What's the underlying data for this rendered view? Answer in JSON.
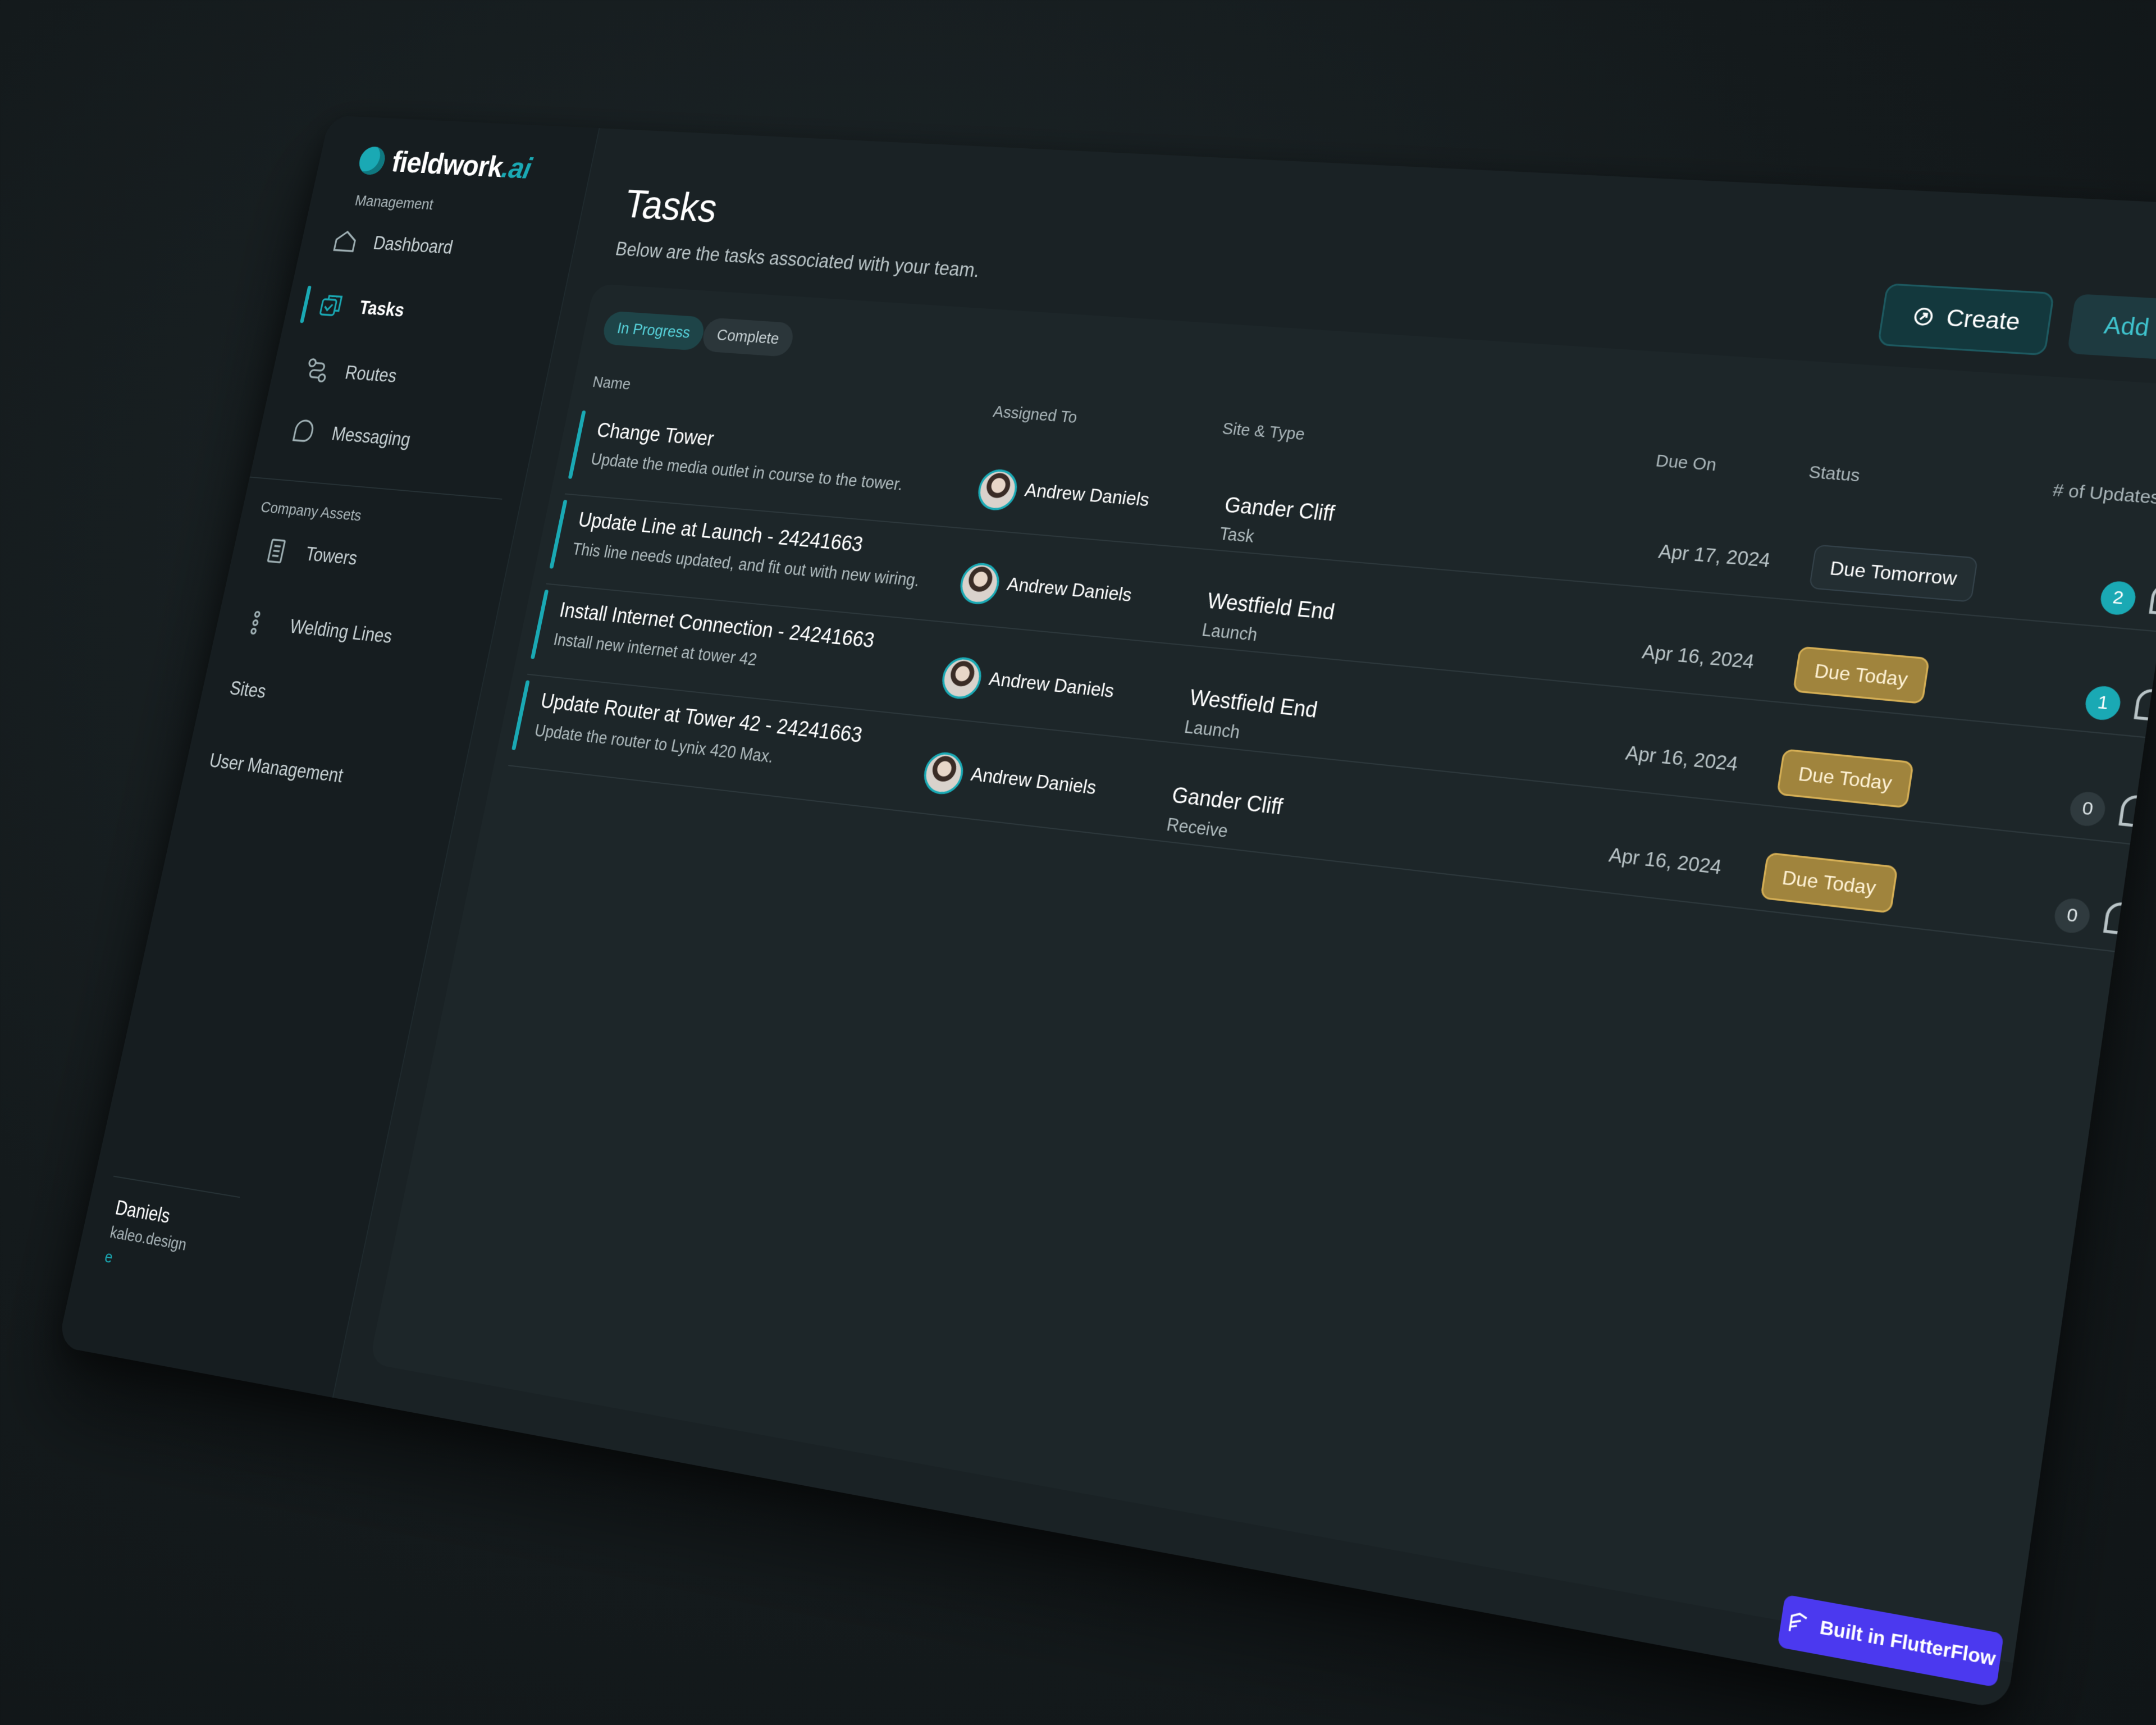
{
  "brand": {
    "name": "fieldwork",
    "suffix": ".ai"
  },
  "sidebar": {
    "section_management": "Management",
    "section_assets": "Company Assets",
    "items": [
      {
        "label": "Dashboard",
        "icon": "home-icon"
      },
      {
        "label": "Tasks",
        "icon": "tasks-icon",
        "active": true
      },
      {
        "label": "Routes",
        "icon": "routes-icon"
      },
      {
        "label": "Messaging",
        "icon": "messaging-icon"
      }
    ],
    "asset_items": [
      {
        "label": "Towers",
        "icon": "tower-icon"
      },
      {
        "label": "Welding Lines",
        "icon": "welding-icon"
      },
      {
        "label": "Sites",
        "icon": ""
      },
      {
        "label": "User Management",
        "icon": ""
      }
    ],
    "user": {
      "name": "Daniels",
      "email": "kaleo.design",
      "link": "e"
    }
  },
  "header": {
    "title": "Tasks",
    "subtitle": "Below are the tasks associated with your team.",
    "create_label": "Create",
    "add_task_label": "Add Task"
  },
  "filters": {
    "in_progress": "In Progress",
    "complete": "Complete"
  },
  "columns": {
    "name": "Name",
    "assigned_to": "Assigned To",
    "site_type": "Site & Type",
    "due_on": "Due On",
    "status": "Status",
    "updates": "# of Updates"
  },
  "rows": [
    {
      "title": "Change Tower",
      "desc": "Update the media outlet in course to the tower.",
      "assignee": "Andrew Daniels",
      "site": "Gander Cliff",
      "type": "Task",
      "due": "Apr 17, 2024",
      "status": "Due Tomorrow",
      "updates": "2"
    },
    {
      "title": "Update Line at Launch - 24241663",
      "desc": "This line needs updated, and fit out with new wiring.",
      "assignee": "Andrew Daniels",
      "site": "Westfield End",
      "type": "Launch",
      "due": "Apr 16, 2024",
      "status": "Due Today",
      "updates": "1"
    },
    {
      "title": "Install Internet Connection - 24241663",
      "desc": "Install new internet at tower 42",
      "assignee": "Andrew Daniels",
      "site": "Westfield End",
      "type": "Launch",
      "due": "Apr 16, 2024",
      "status": "Due Today",
      "updates": "0"
    },
    {
      "title": "Update Router at Tower 42 - 24241663",
      "desc": "Update the router to Lynix 420 Max.",
      "assignee": "Andrew Daniels",
      "site": "Gander Cliff",
      "type": "Receive",
      "due": "Apr 16, 2024",
      "status": "Due Today",
      "updates": "0"
    }
  ],
  "badge": {
    "label": "Built in FlutterFlow"
  },
  "colors": {
    "accent": "#1aa9b4",
    "due_today": "#a0843d",
    "flutterflow": "#4b39ef"
  }
}
